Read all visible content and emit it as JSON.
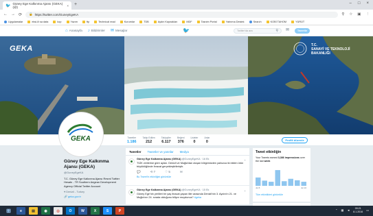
{
  "browser": {
    "tab_title": "Güney Ege Kalkınma Ajansı (GEKA) (@)",
    "new_tab": "+",
    "address": "https://twitter.com/GuneyEgeKA",
    "window_controls": [
      "–",
      "□",
      "×"
    ],
    "bookmarks": [
      "Uygulamalar",
      "eksi-ili sa data",
      "kop",
      "Yazım",
      "ftp",
      "Technical read",
      "Kurumlar",
      "TDB",
      "Aydın Kaynakları",
      "MDF",
      "Tasnim Portal",
      "Yatırıma Destek",
      "Search",
      "KOBİ TAHOM",
      "YÜRÜT"
    ]
  },
  "twitter_nav": {
    "items": [
      {
        "icon": "home-icon",
        "label": "Anasayfa"
      },
      {
        "icon": "bell-icon",
        "label": "Bildirimler"
      },
      {
        "icon": "message-icon",
        "label": "Mesajlar"
      }
    ],
    "search_placeholder": "Twitter'da ara",
    "tweet_button": "Tweetle"
  },
  "banner": {
    "logo_text": "GEKA",
    "right_title_1": "T.C.",
    "right_title_2": "SANAYİ VE TEKNOLOJİ",
    "right_title_3": "BAKANLIĞI",
    "avatar_text": "GEKA"
  },
  "stats": [
    {
      "label": "Tweetler",
      "value": "1.186",
      "active": true
    },
    {
      "label": "Takip Edilen",
      "value": "212",
      "active": false
    },
    {
      "label": "Takipçiler",
      "value": "6.117",
      "active": false
    },
    {
      "label": "Beğeni",
      "value": "376",
      "active": false
    },
    {
      "label": "Listeler",
      "value": "0",
      "active": false
    },
    {
      "label": "Anlar",
      "value": "0",
      "active": false
    }
  ],
  "follow_button": "Profili düzenle",
  "profile": {
    "name": "Güney Ege Kalkınma Ajansı (GEKA)",
    "handle": "@GuneyEgeKA",
    "bio": "T.C. Güney Ege Kalkınma Ajansı Resmi Twitter Hesabı - TR Southern Aegean Development Agency Official Twitter Account",
    "location": "Denizli - Turkey",
    "link": "geka.gov.tr"
  },
  "timeline": {
    "tabs": [
      "Tweetler",
      "Tweetler ve yanıtlar",
      "Medya"
    ],
    "tweets": [
      {
        "name": "Güney Ege Kalkınma Ajansı (GEKA)",
        "handle": "@GuneyEgeKA · 16 Ek",
        "text": "TÜİK verilerine göre ayları. Denizli ve Muğla'dan oluşan bölgemizden yalnızca iki ekilen ürün büyüklüğünde ihracat gerçekleştirilmiştir.",
        "actions": [
          "💬",
          "⟲ 7",
          "♡ 5",
          "✉"
        ],
        "more": "Bu Tweet'in etkinliğini görüntüle"
      },
      {
        "name": "Güney Ege Kalkınma Ajansı (GEKA)",
        "handle": "@GuneyEgeKA · 15 Ek",
        "text": "Güney Ege'nin yerlileri bir yaş ihracat yapan iller arasında Denizli'nin 3. Aydın'ın 21. ve Muğla'nın 24. sırada olduğunu biliyor muydunuz?",
        "link": "#geka",
        "actions": [],
        "more": ""
      }
    ]
  },
  "activity": {
    "title": "Tweet etkinliğin",
    "text_prefix": "Your Tweets earned ",
    "impressions": "3,386 impressions",
    "text_suffix": " over the last ",
    "period": "week",
    "date_start": "Jul 8",
    "date_end": "Jul 16",
    "link": "Tüm etkinlikleri görüntüle",
    "bars": [
      0.45,
      0.28,
      0.22,
      0.85,
      0.25,
      0.38,
      0.3,
      0.22
    ]
  },
  "taskbar": {
    "clock_time": "09:21",
    "clock_date": "8.1.2016"
  }
}
